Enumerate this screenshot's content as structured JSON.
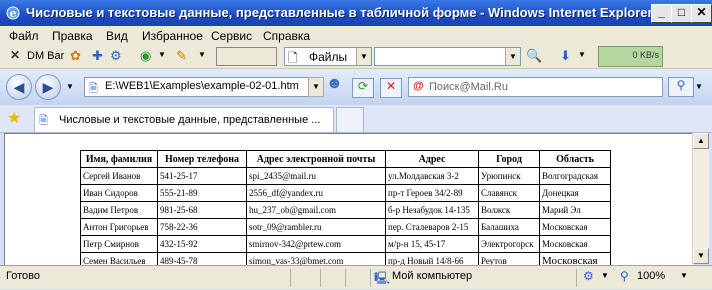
{
  "window": {
    "title": "Числовые и текстовые данные, представленные в табличной форме - Windows Internet Explorer"
  },
  "menu": [
    "Файл",
    "Правка",
    "Вид",
    "Избранное",
    "Сервис",
    "Справка"
  ],
  "toolbar": {
    "dm_bar": "DM Bar",
    "folder_combo": "Файлы",
    "speed": "0 KB/s"
  },
  "nav": {
    "address": "E:\\WEB1\\Examples\\example-02-01.htm",
    "search_placeholder": "Поиск@Mail.Ru"
  },
  "tab": {
    "label": "Числовые и текстовые данные, представленные ..."
  },
  "table": {
    "headers": [
      "Имя, фамилия",
      "Номер телефона",
      "Адрес электронной почты",
      "Адрес",
      "Город",
      "Область"
    ],
    "rows": [
      [
        "Сергей Иванов",
        "541-25-17",
        "spi_2435@mail.ru",
        "ул.Молдавская 3-2",
        "Урюпинск",
        "Волгоградская"
      ],
      [
        "Иван Сидоров",
        "555-21-89",
        "2556_df@yandex.ru",
        "пр-т Героев 34/2-89",
        "Славянск",
        "Донецкая"
      ],
      [
        "Вадим Петров",
        "981-25-68",
        "hu_237_ob@gmail.com",
        "б-р Незабудок 14-135",
        "Волжск",
        "Марий Эл"
      ],
      [
        "Антон Григорьев",
        "758-22-36",
        "sotr_09@rambler.ru",
        "пер. Сталеваров 2-15",
        "Балашиха",
        "Московская"
      ],
      [
        "Петр Смирнов",
        "432-15-92",
        "smirnov-342@prtew.com",
        "м/р-н 15, 45-17",
        "Электрогорск",
        "Московская"
      ],
      [
        "Семен Васильев",
        "489-45-78",
        "simon_vas-33@bmet.com",
        "пр-д Новый 14/8-66",
        "Реутов",
        "Московская"
      ]
    ]
  },
  "status": {
    "left": "Готово",
    "zone": "Мой компьютер",
    "zoom": "100%"
  }
}
